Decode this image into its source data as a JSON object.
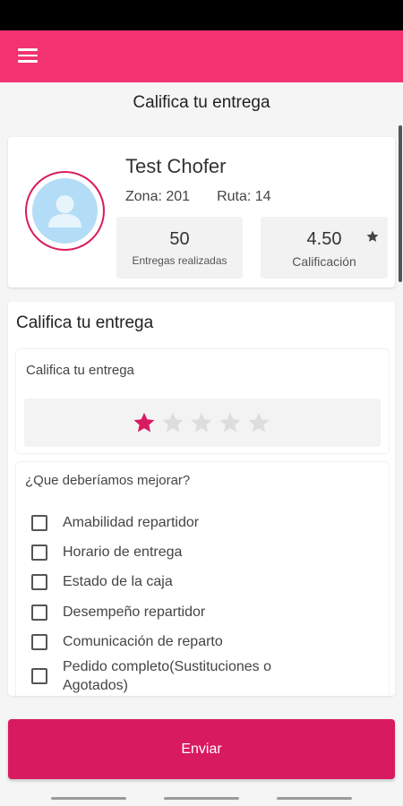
{
  "header": {
    "menu_icon": "hamburger-menu-icon",
    "title": "Califica tu entrega",
    "accent_color": "#f2336f"
  },
  "driver": {
    "avatar_icon": "user-avatar-icon",
    "name": "Test Chofer",
    "zone_label": "Zona: 201",
    "route_label": "Ruta: 14",
    "deliveries_value": "50",
    "deliveries_label": "Entregas realizadas",
    "rating_value": "4.50",
    "rating_label": "Calificación",
    "rating_icon": "star-icon"
  },
  "rating": {
    "heading": "Califica tu entrega",
    "box_label": "Califica tu entrega",
    "stars_total": 5,
    "stars_selected": 1,
    "star_active_color": "#d81b60",
    "star_inactive_color": "#dddddd"
  },
  "improve": {
    "label": "¿Que deberíamos mejorar?",
    "options": [
      {
        "label": "Amabilidad repartidor",
        "checked": false
      },
      {
        "label": "Horario de entrega",
        "checked": false
      },
      {
        "label": "Estado de la caja",
        "checked": false
      },
      {
        "label": "Desempeño repartidor",
        "checked": false
      },
      {
        "label": "Comunicación de reparto",
        "checked": false
      },
      {
        "label": "Pedido completo(Sustituciones o Agotados)",
        "checked": false
      }
    ]
  },
  "actions": {
    "send_label": "Enviar",
    "send_color": "#d81b60"
  }
}
